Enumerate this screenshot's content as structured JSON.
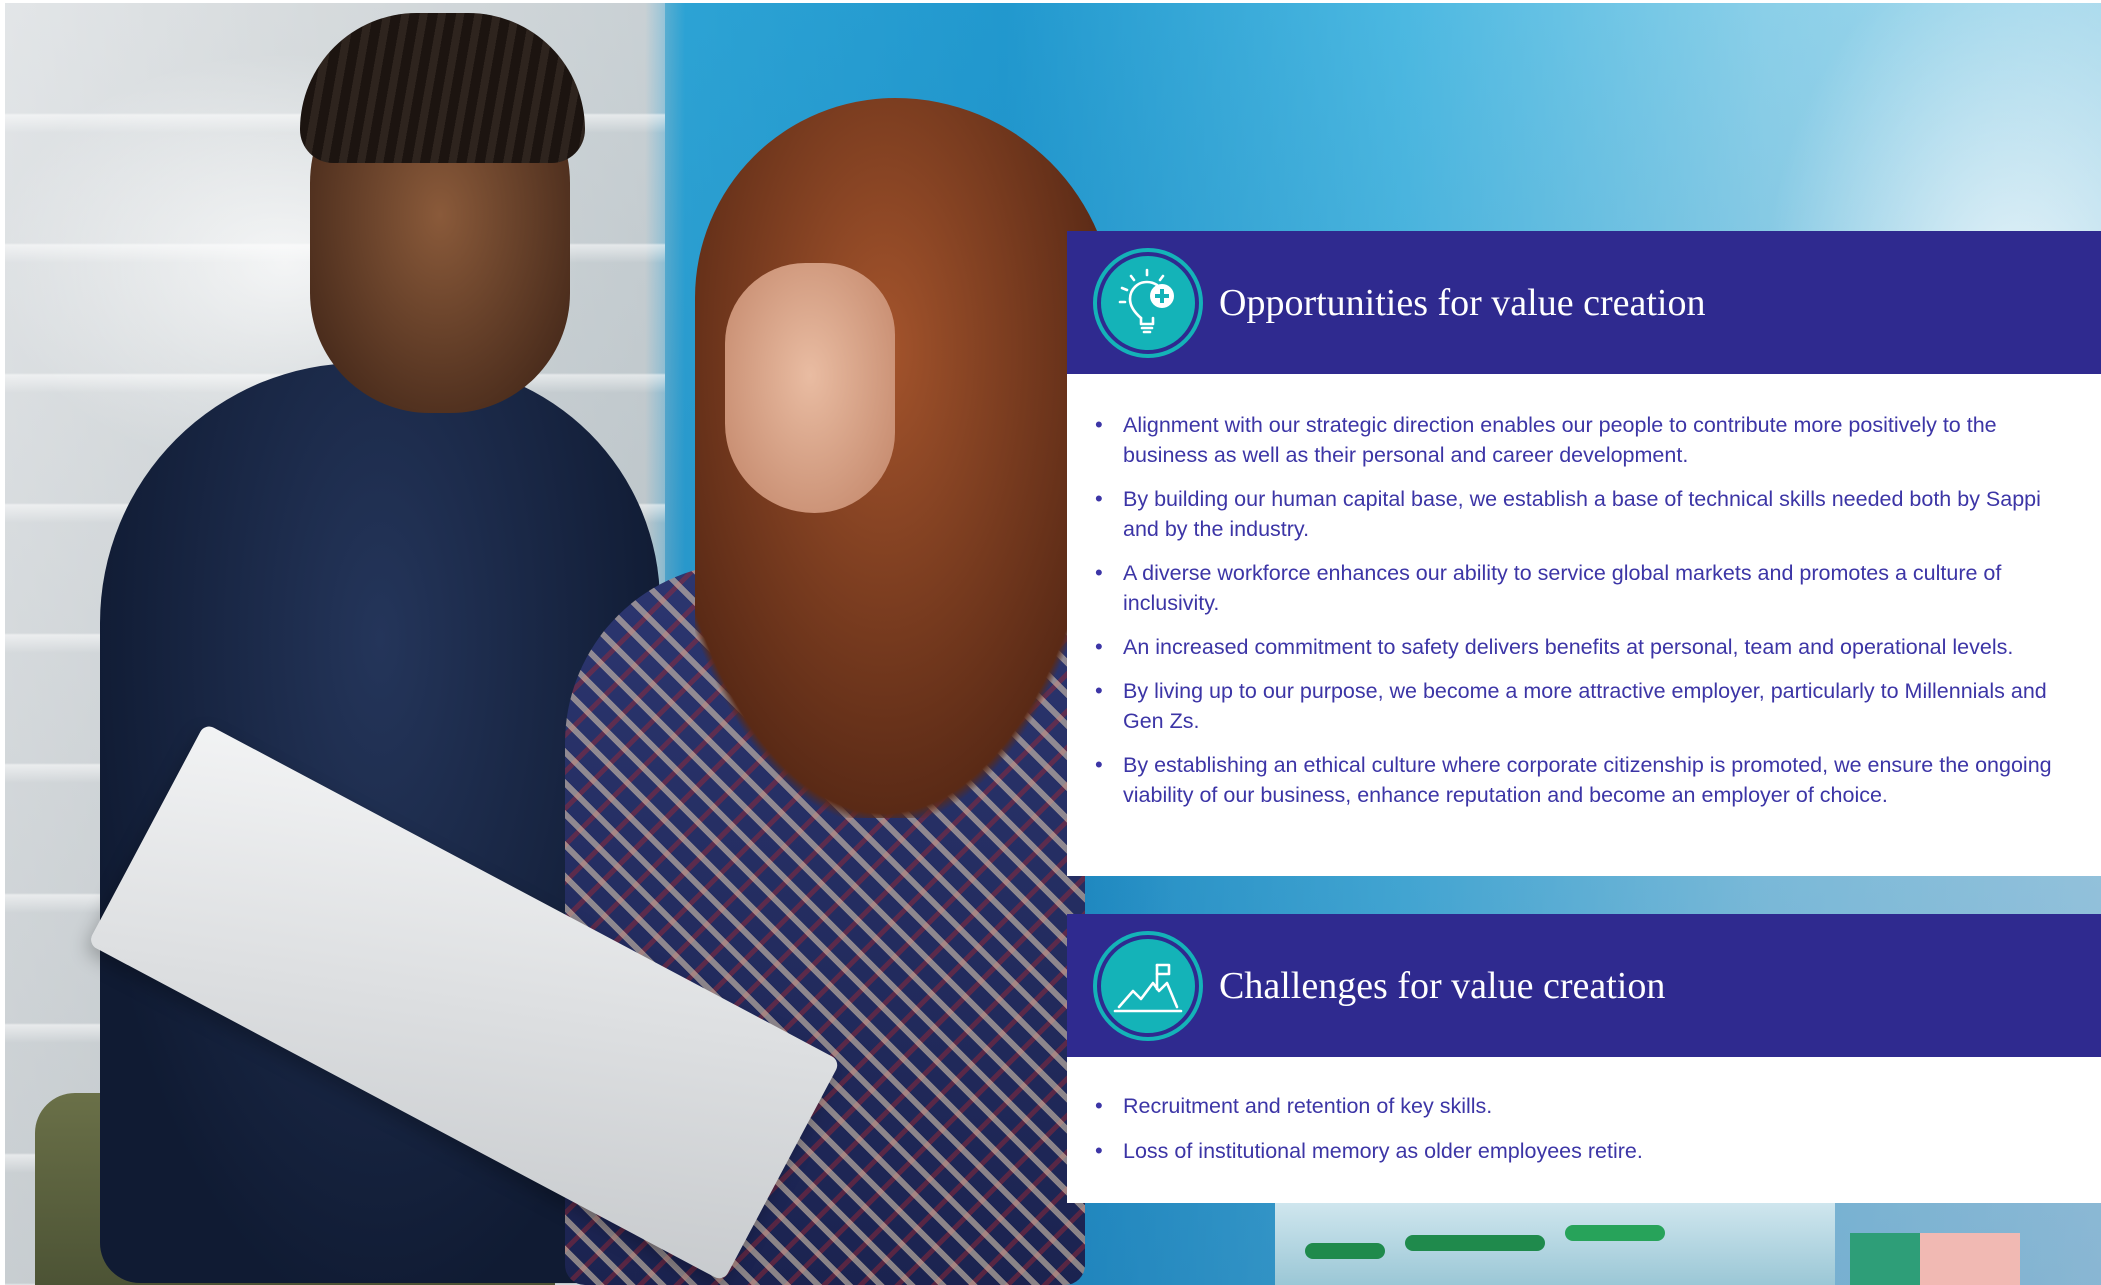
{
  "opportunities": {
    "title": "Opportunities for value creation",
    "icon": "lightbulb-plus-icon",
    "items": [
      "Alignment with our strategic direction enables our people to contribute more positively to the business as well as their personal and career development.",
      "By building our human capital base, we establish a base of technical skills needed both by Sappi and by the industry.",
      "A diverse workforce enhances our ability to service global markets and promotes a culture of inclusivity.",
      "An increased commitment to safety delivers benefits at personal, team and operational levels.",
      "By living up to our purpose, we become a more attractive employer, particularly to Millennials and Gen Zs.",
      "By establishing an ethical culture where corporate citizenship is promoted, we ensure the ongoing viability of our business, enhance reputation and become an employer of choice."
    ]
  },
  "challenges": {
    "title": "Challenges for value creation",
    "icon": "mountain-flag-icon",
    "items": [
      "Recruitment and retention of key skills.",
      "Loss of institutional memory as older employees retire."
    ]
  },
  "colors": {
    "header_bg": "#2f2a8f",
    "icon_bg": "#14b3b8",
    "body_text": "#3c35a6"
  }
}
